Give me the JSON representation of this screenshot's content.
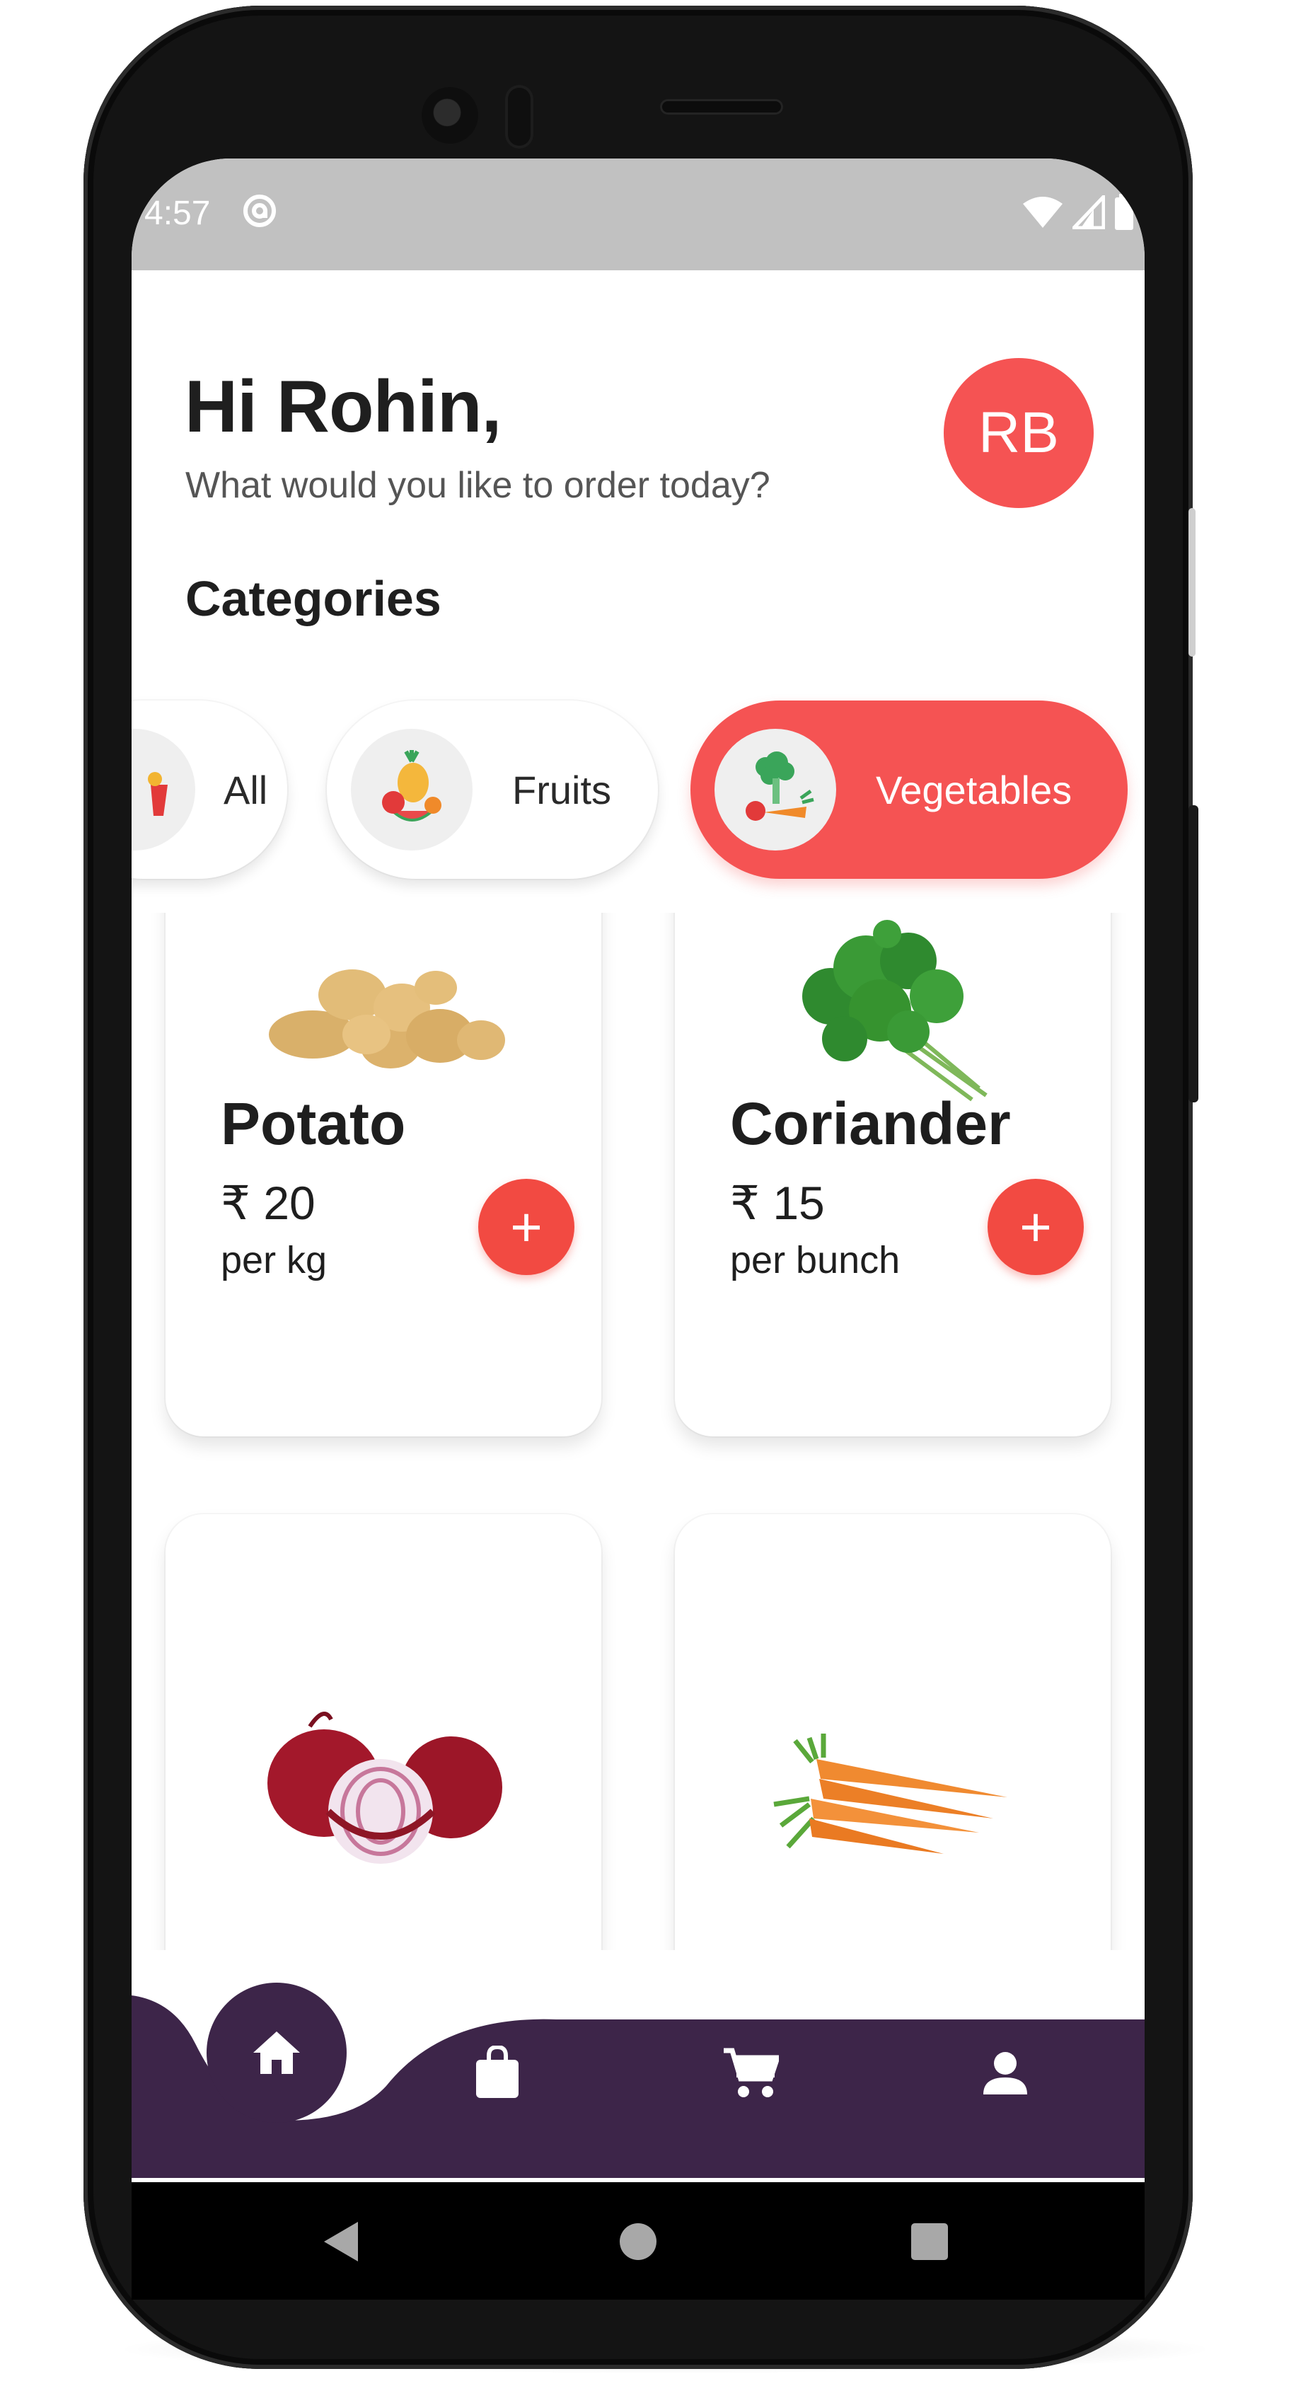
{
  "status_bar": {
    "time": "4:57",
    "left_icons": [
      "at-sign-icon"
    ],
    "right_icons": [
      "wifi-icon",
      "signal-icon",
      "battery-icon"
    ]
  },
  "header": {
    "greeting": "Hi Rohin,",
    "subtitle": "What would you like to order today?",
    "avatar_initials": "RB"
  },
  "categories": {
    "title": "Categories",
    "items": [
      {
        "label": "All",
        "icon": "basket-icon",
        "selected": false
      },
      {
        "label": "Fruits",
        "icon": "fruits-icon",
        "selected": false
      },
      {
        "label": "Vegetables",
        "icon": "vegetables-icon",
        "selected": true
      }
    ]
  },
  "products": [
    {
      "name": "Potato",
      "price": "₹ 20",
      "unit": "per kg",
      "image": "potato-image"
    },
    {
      "name": "Coriander",
      "price": "₹ 15",
      "unit": "per bunch",
      "image": "coriander-image"
    },
    {
      "name": "",
      "price": "",
      "unit": "",
      "image": "onion-image"
    },
    {
      "name": "",
      "price": "",
      "unit": "",
      "image": "carrot-image"
    }
  ],
  "bottom_nav": {
    "items": [
      {
        "icon": "home-icon",
        "active": true
      },
      {
        "icon": "shopping-bag-icon",
        "active": false
      },
      {
        "icon": "cart-icon",
        "active": false
      },
      {
        "icon": "person-icon",
        "active": false
      }
    ]
  },
  "system_nav": [
    "back-icon",
    "home-circle-icon",
    "recents-icon"
  ],
  "colors": {
    "accent": "#f55353",
    "add_button": "#f24a42",
    "nav_bar": "#3d2549",
    "status_bar": "#c1c1c1",
    "text_dark": "#1f1f1f",
    "text_muted": "#555555"
  }
}
